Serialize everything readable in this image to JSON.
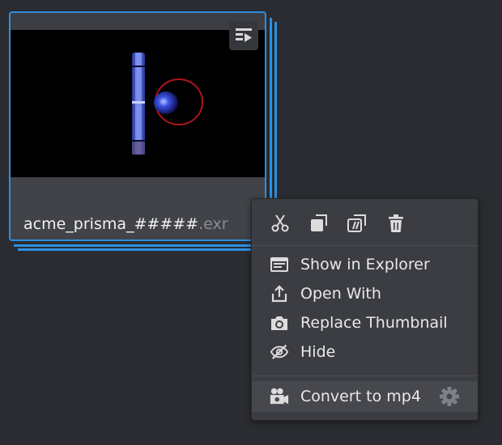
{
  "card": {
    "name": "acme_prisma_#####",
    "extension": ".exr"
  },
  "menu": {
    "toolbar": [
      {
        "icon": "cut-icon"
      },
      {
        "icon": "copy-icon"
      },
      {
        "icon": "copy-path-icon"
      },
      {
        "icon": "trash-icon"
      }
    ],
    "items": [
      {
        "label": "Show in Explorer",
        "icon": "explorer-window-icon"
      },
      {
        "label": "Open With",
        "icon": "share-upload-icon"
      },
      {
        "label": "Replace Thumbnail",
        "icon": "camera-icon"
      },
      {
        "label": "Hide",
        "icon": "eye-slash-icon"
      }
    ],
    "convert": {
      "label": "Convert to mp4",
      "icon": "video-camera-icon",
      "settings_icon": "gear-icon"
    }
  },
  "colors": {
    "background": "#2a2c31",
    "accent": "#2f8fe0",
    "menu_bg": "#3b3d43",
    "text": "#e9e9ea"
  }
}
